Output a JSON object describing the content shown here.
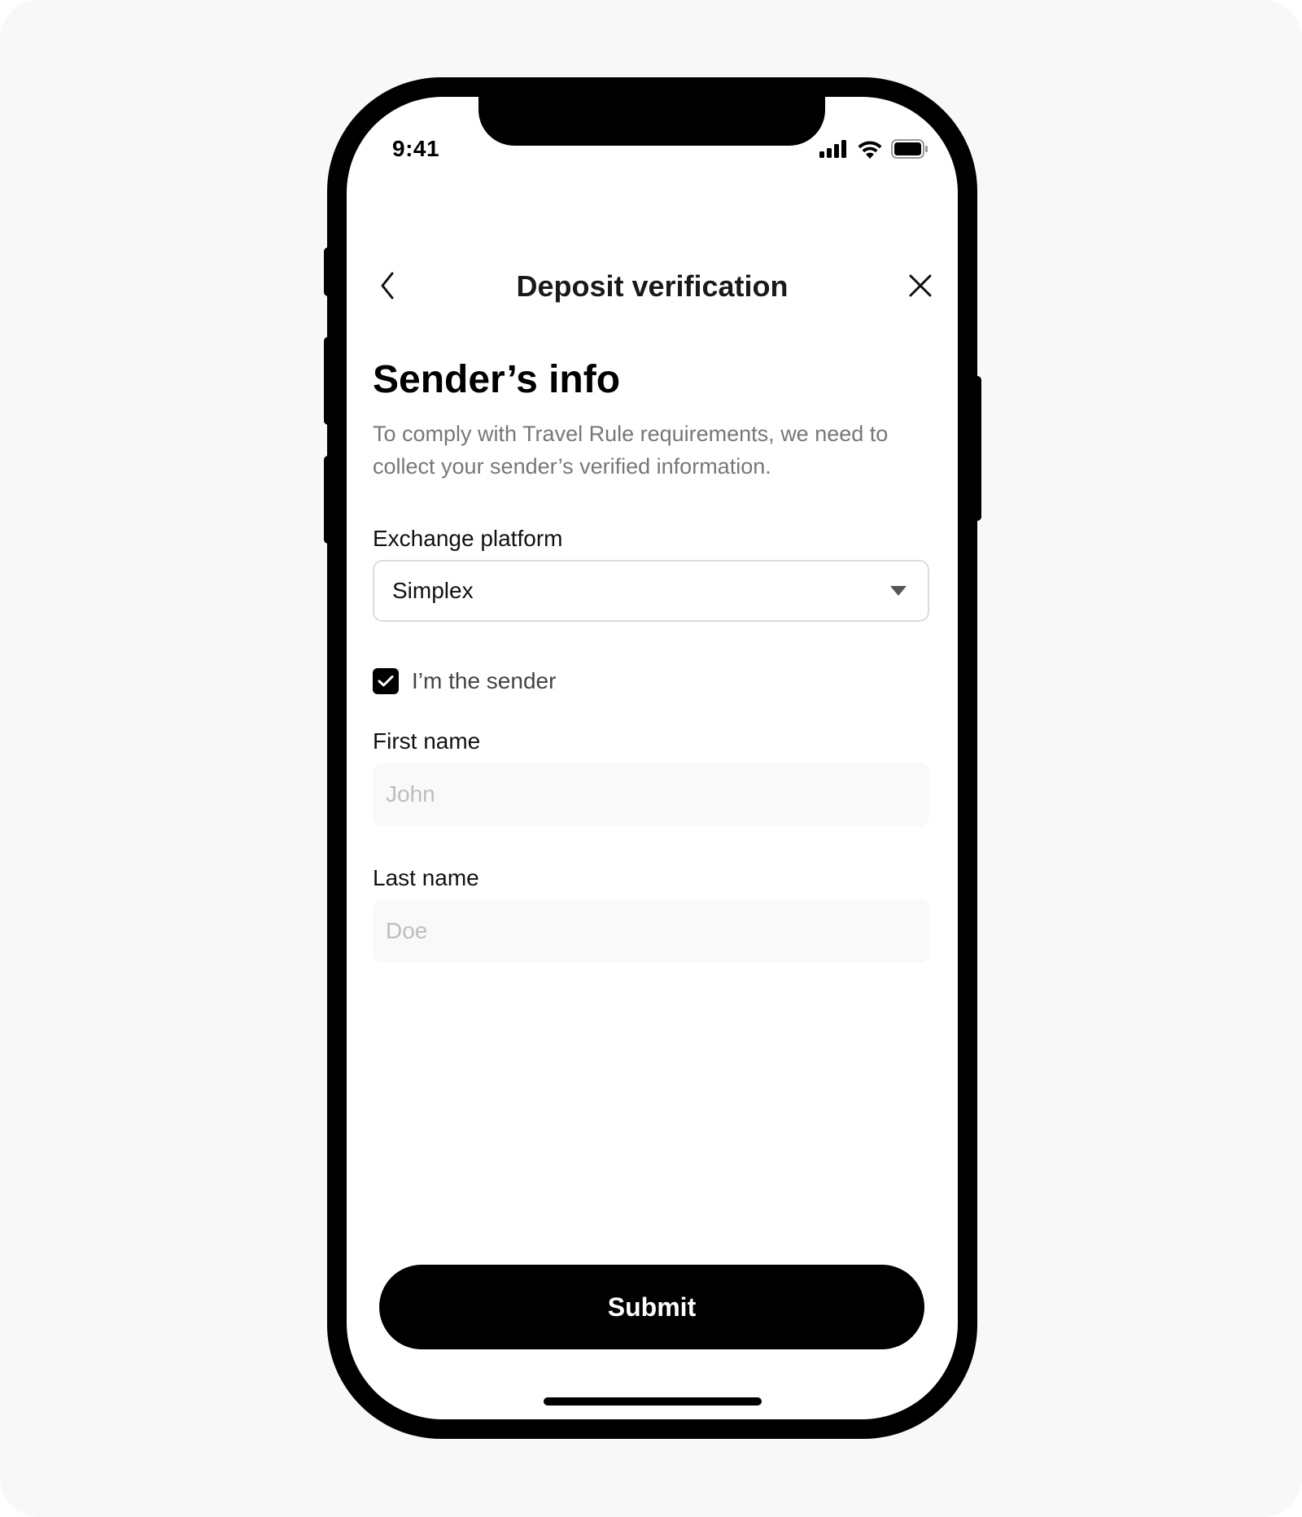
{
  "status_bar": {
    "time": "9:41",
    "icons": [
      "cellular-signal-icon",
      "wifi-icon",
      "battery-icon"
    ]
  },
  "nav": {
    "back_icon": "chevron-left-icon",
    "title": "Deposit verification",
    "close_icon": "close-icon"
  },
  "page": {
    "heading": "Sender’s info",
    "description": "To comply with Travel Rule requirements, we need to collect your sender’s verified information."
  },
  "form": {
    "exchange_platform": {
      "label": "Exchange platform",
      "selected": "Simplex"
    },
    "im_sender": {
      "label": "I’m the sender",
      "checked": true
    },
    "first_name": {
      "label": "First name",
      "value": "",
      "placeholder": "John"
    },
    "last_name": {
      "label": "Last name",
      "value": "",
      "placeholder": "Doe"
    },
    "submit_label": "Submit"
  },
  "colors": {
    "background": "#f8f8f8",
    "phone_frame": "#000000",
    "primary_button": "#000000",
    "text_primary": "#111111",
    "text_secondary": "#777777",
    "input_fill": "#f9f9f9",
    "placeholder": "#bdbdbd"
  }
}
